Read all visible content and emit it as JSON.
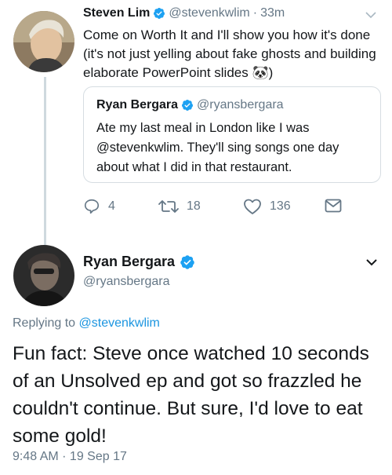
{
  "tweet1": {
    "display_name": "Steven Lim",
    "handle": "@stevenkwlim",
    "separator": "·",
    "age": "33m",
    "text": "Come on Worth It and I'll show you how it's done (it's not just yelling about fake ghosts and building elaborate PowerPoint slides 🐼)",
    "quote": {
      "display_name": "Ryan Bergara",
      "handle": "@ryansbergara",
      "text": "Ate my last meal in London like I was @stevenkwlim. They'll sing songs one day about what I did in that restaurant."
    },
    "actions": {
      "replies": "4",
      "retweets": "18",
      "likes": "136"
    }
  },
  "tweet2": {
    "display_name": "Ryan Bergara",
    "handle": "@ryansbergara",
    "replying_prefix": "Replying to",
    "replying_to": "@stevenkwlim",
    "text": "Fun fact: Steve once watched 10 seconds of an Unsolved ep and got so frazzled he couldn't continue. But sure, I'd love to eat some gold!",
    "timestamp": "9:48 AM · 19 Sep 17"
  },
  "colors": {
    "verified": "#1da1f2",
    "link": "#1b95e0",
    "muted": "#657786",
    "border": "#d6dde2"
  }
}
